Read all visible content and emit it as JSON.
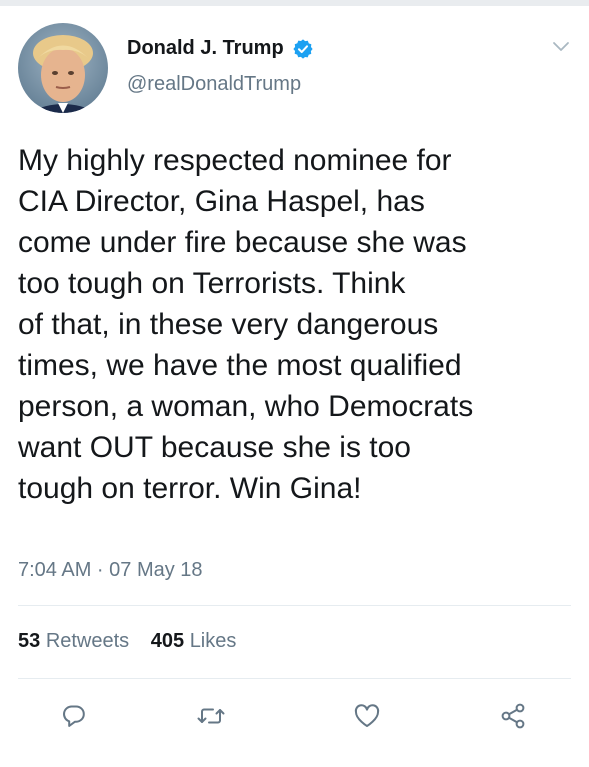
{
  "author": {
    "name": "Donald J. Trump",
    "handle": "@realDonaldTrump"
  },
  "tweet": {
    "lines": [
      "My highly respected nominee for",
      "CIA Director, Gina Haspel, has",
      "come under fire because she was",
      "too tough on Terrorists. Think",
      "of that, in these very dangerous",
      "times, we have the most qualified",
      "person, a woman, who Democrats",
      "want OUT because she is too",
      "tough on terror. Win Gina!"
    ],
    "timestamp": "7:04 AM · 07 May 18"
  },
  "stats": {
    "retweets_count": "53",
    "retweets_label": "Retweets",
    "likes_count": "405",
    "likes_label": "Likes"
  },
  "icons": {
    "verified": "verified-badge-icon",
    "menu": "chevron-down-icon",
    "reply": "reply-icon",
    "retweet": "retweet-icon",
    "like": "heart-icon",
    "share": "share-icon"
  },
  "colors": {
    "text_primary": "#14171a",
    "text_secondary": "#657786",
    "verified_blue": "#1da1f2",
    "divider": "#e6ecf0"
  }
}
